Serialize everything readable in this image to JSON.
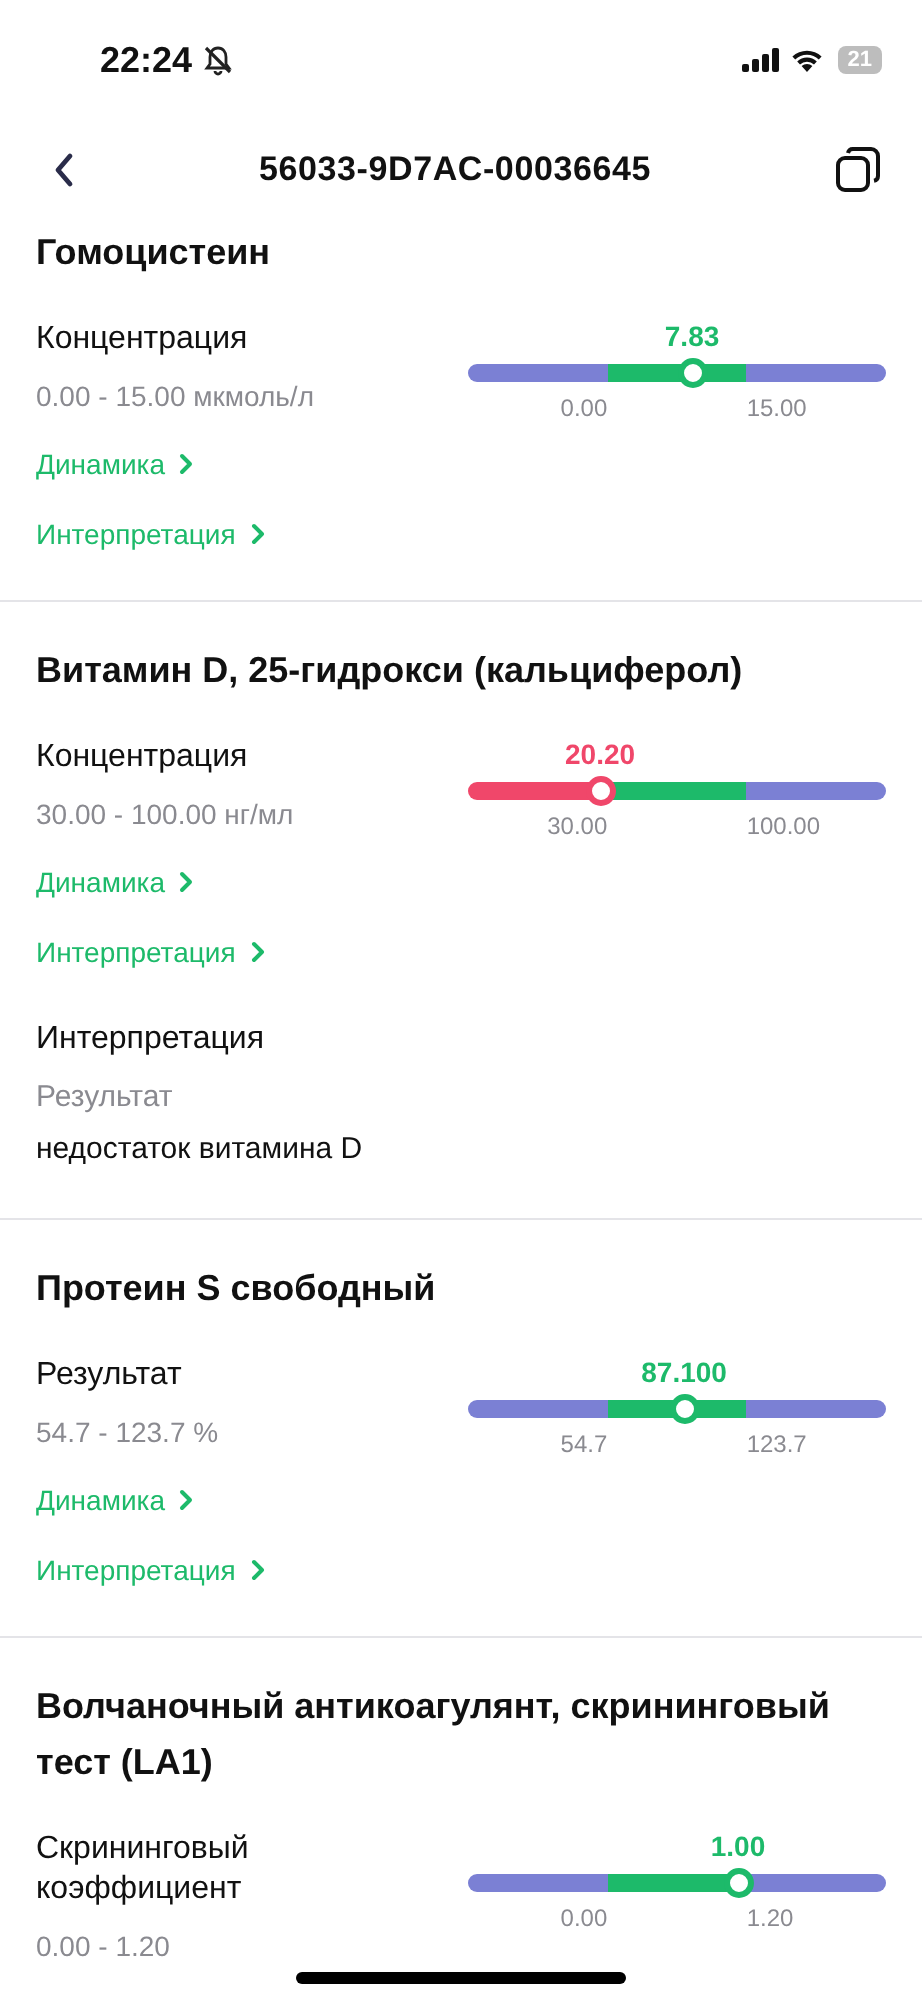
{
  "status_bar": {
    "time": "22:24",
    "battery": "21"
  },
  "nav": {
    "title": "56033-9D7AC-00036645"
  },
  "sections": [
    {
      "title": "Гомоцистеин",
      "measures": [
        {
          "label": "Концентрация",
          "range": "0.00 - 15.00 мкмоль/л",
          "value": "7.83",
          "low": false,
          "level": 0.536,
          "min": "0.00",
          "max": "15.00"
        }
      ],
      "links": [
        "Динамика",
        "Интерпретация"
      ]
    },
    {
      "title": "Витамин D, 25-гидрокси (кальциферол)",
      "measures": [
        {
          "label": "Концентрация",
          "range": "30.00 - 100.00 нг/мл",
          "value": "20.20",
          "low": true,
          "level": 0.316,
          "min": "30.00",
          "max": "100.00"
        }
      ],
      "links": [
        "Динамика",
        "Интерпретация"
      ],
      "interpretation": {
        "heading": "Интерпретация",
        "label": "Результат",
        "value": "недостаток витамина D"
      }
    },
    {
      "title": "Протеин S свободный",
      "measures": [
        {
          "label": "Результат",
          "range": "54.7 - 123.7 %",
          "value": "87.100",
          "low": false,
          "level": 0.517,
          "min": "54.7",
          "max": "123.7"
        }
      ],
      "links": [
        "Динамика",
        "Интерпретация"
      ]
    },
    {
      "title": "Волчаночный антикоагулянт, скрининговый тест (LA1)",
      "measures": [
        {
          "label": "Скрининговый коэффициент",
          "range": "0.00 - 1.20",
          "value": "1.00",
          "low": false,
          "level": 0.646,
          "min": "0.00",
          "max": "1.20"
        }
      ]
    }
  ]
}
